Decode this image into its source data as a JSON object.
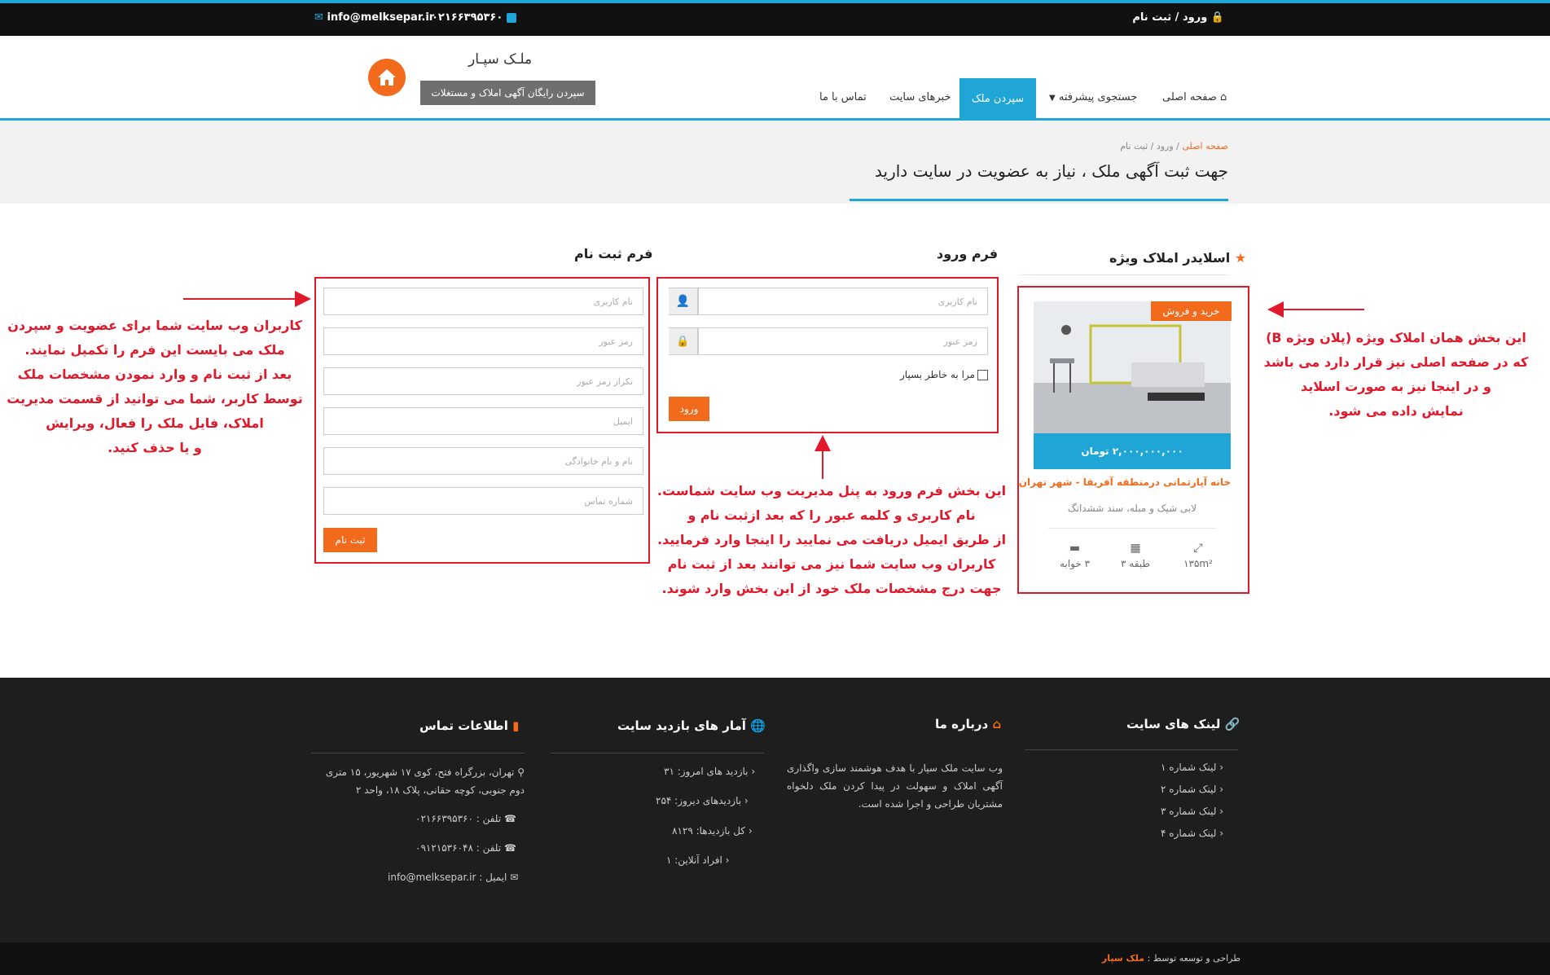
{
  "topbar": {
    "login_register": "ورود / ثبت نام",
    "phone": "۰۲۱۶۶۳۹۵۳۶۰",
    "email": "info@melksepar.ir"
  },
  "brand": {
    "title": "ملـک سپـار",
    "slogan": "سپردن رایگان آگهی املاک و مستغلات"
  },
  "nav": {
    "home": "صفحه اصلی",
    "advanced_search": "جستجوی پیشرفته",
    "submit": "سپردن ملک",
    "news": "خبرهای سایت",
    "contact": "تماس با ما"
  },
  "breadcrumb": {
    "home": "صفحه اصلی",
    "sep": "/",
    "current": "ورود / ثبت نام"
  },
  "page_title": "جهت ثبت آگهی ملک ، نیاز به عضویت در سایت دارید",
  "slider": {
    "title": "اسلایدر املاک ویژه",
    "badge": "خرید و فروش",
    "price": "۲,۰۰۰,۰۰۰,۰۰۰ تومان",
    "name": "خانه آپارتمانی درمنطقه آفریقا - شهر تهران",
    "features": "لابی شیک و مبله، سند ششدانگ",
    "area": "۱۳۵m²",
    "floor": "طبقه ۳",
    "beds": "۳ خوابه"
  },
  "login": {
    "title": "فرم ورود",
    "username_ph": "نام کاربری",
    "password_ph": "رمز عبور",
    "remember": "مرا به خاطر بسپار",
    "submit": "ورود"
  },
  "register": {
    "title": "فرم ثبت نام",
    "username_ph": "نام کاربری",
    "password_ph": "رمز عبور",
    "password2_ph": "تکرار رمز عبور",
    "email_ph": "ایمیل",
    "fullname_ph": "نام و نام خانوادگی",
    "phone_ph": "شماره تماس",
    "submit": "ثبت نام"
  },
  "annotations": {
    "right": [
      "این بخش همان املاک ویژه (پلان ویژه B)",
      "که در صفحه اصلی نیز قرار دارد می باشد",
      "و در اینجا نیز به صورت اسلاید",
      "نمایش داده می شود."
    ],
    "middle": [
      "این بخش فرم ورود به پنل مدیریت وب سایت شماست.",
      "نام کاربری و کلمه عبور را که بعد ازثبت نام و",
      "از طریق ایمیل دریافت می نمایید را اینجا وارد فرمایید.",
      "کاربران وب سایت شما نیز می توانند بعد از ثبت نام",
      "جهت درج مشخصات ملک خود از این بخش وارد شوند."
    ],
    "left": [
      "کاربران وب سایت شما برای عضویت و سپردن",
      "ملک می بایست این فرم را تکمیل نمایند.",
      "بعد از ثبت نام و وارد نمودن مشخصات ملک",
      "توسط کاربر، شما می توانید از قسمت مدیریت",
      "املاک، فایل ملک را فعال، ویرایش",
      "و یا حذف کنید."
    ]
  },
  "footer": {
    "links_title": "لینک های سایت",
    "links": [
      "لینک شماره ۱",
      "لینک شماره ۲",
      "لینک شماره ۳",
      "لینک شماره ۴"
    ],
    "about_title": "درباره ما",
    "about_text": "وب سایت ملک سپار با هدف هوشمند سازی واگذاری آگهی املاک و سهولت در پیدا کردن ملک دلخواه مشتریان طراحی و اجرا شده است.",
    "stats_title": "آمار های بازدید سایت",
    "stats": [
      "بازدید های امروز: ۳۱",
      "بازدیدهای دیروز: ۲۵۴",
      "کل بازدیدها: ۸۱۲۹",
      "افراد آنلاین: ۱"
    ],
    "contact_title": "اطلاعات تماس",
    "address_1": "تهران، بزرگراه فتح، کوی ۱۷ شهریور، ۱۵ متری",
    "address_2": "دوم جنوبی، کوچه حقانی، پلاک ۱۸، واحد ۲",
    "phone": "تلفن : ۰۲۱۶۶۳۹۵۳۶۰",
    "mobile": "تلفن : ۰۹۱۲۱۵۳۶۰۴۸",
    "email": "ایمیل : info@melksepar.ir"
  },
  "copyright": {
    "prefix": "طراحی و توسعه توسط :",
    "brand": "ملک سپار"
  },
  "colors": {
    "accent": "#1fa6d6",
    "orange": "#f26b1d",
    "annotation": "#e0192b"
  }
}
